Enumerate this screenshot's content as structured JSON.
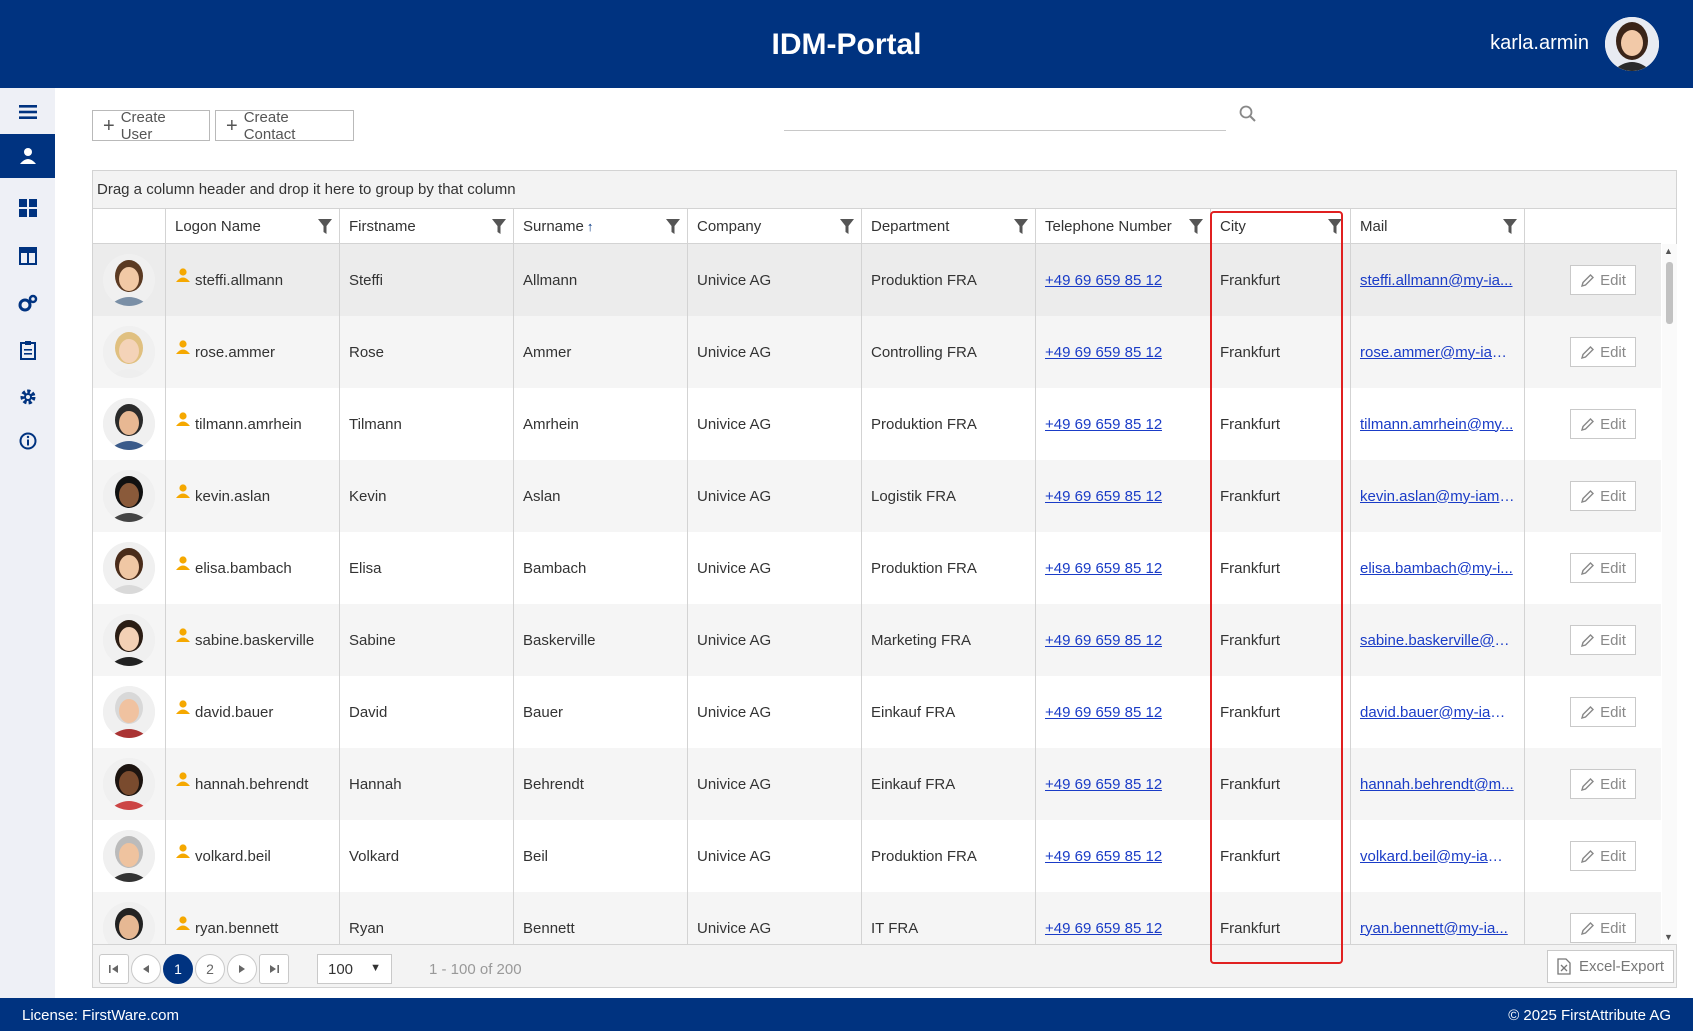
{
  "app": {
    "title": "IDM-Portal",
    "username": "karla.armin"
  },
  "sidebar": {
    "items": [
      {
        "name": "menu-icon"
      },
      {
        "name": "user-icon"
      },
      {
        "name": "dashboard-icon"
      },
      {
        "name": "columns-icon"
      },
      {
        "name": "gears-icon"
      },
      {
        "name": "clipboard-icon"
      },
      {
        "name": "settings-icon"
      },
      {
        "name": "info-icon"
      }
    ]
  },
  "toolbar": {
    "create_user": "Create User",
    "create_contact": "Create Contact",
    "search_placeholder": "",
    "search_value": ""
  },
  "grid": {
    "group_hint": "Drag a column header and drop it here to group by that column",
    "columns": [
      "Logon Name",
      "Firstname",
      "Surname",
      "Company",
      "Department",
      "Telephone Number",
      "City",
      "Mail"
    ],
    "sort_column": "Surname",
    "sort_indicator": "↑",
    "edit_label": "Edit",
    "rows": [
      {
        "logon": "steffi.allmann",
        "first": "Steffi",
        "last": "Allmann",
        "company": "Univice AG",
        "dept": "Produktion FRA",
        "phone": "+49 69 659 85 12",
        "city": "Frankfurt",
        "mail": "steffi.allmann@my-ia..."
      },
      {
        "logon": "rose.ammer",
        "first": "Rose",
        "last": "Ammer",
        "company": "Univice AG",
        "dept": "Controlling FRA",
        "phone": "+49 69 659 85 12",
        "city": "Frankfurt",
        "mail": "rose.ammer@my-iam..."
      },
      {
        "logon": "tilmann.amrhein",
        "first": "Tilmann",
        "last": "Amrhein",
        "company": "Univice AG",
        "dept": "Produktion FRA",
        "phone": "+49 69 659 85 12",
        "city": "Frankfurt",
        "mail": "tilmann.amrhein@my..."
      },
      {
        "logon": "kevin.aslan",
        "first": "Kevin",
        "last": "Aslan",
        "company": "Univice AG",
        "dept": "Logistik FRA",
        "phone": "+49 69 659 85 12",
        "city": "Frankfurt",
        "mail": "kevin.aslan@my-iam...."
      },
      {
        "logon": "elisa.bambach",
        "first": "Elisa",
        "last": "Bambach",
        "company": "Univice AG",
        "dept": "Produktion FRA",
        "phone": "+49 69 659 85 12",
        "city": "Frankfurt",
        "mail": "elisa.bambach@my-i..."
      },
      {
        "logon": "sabine.baskerville",
        "first": "Sabine",
        "last": "Baskerville",
        "company": "Univice AG",
        "dept": "Marketing FRA",
        "phone": "+49 69 659 85 12",
        "city": "Frankfurt",
        "mail": "sabine.baskerville@m..."
      },
      {
        "logon": "david.bauer",
        "first": "David",
        "last": "Bauer",
        "company": "Univice AG",
        "dept": "Einkauf FRA",
        "phone": "+49 69 659 85 12",
        "city": "Frankfurt",
        "mail": "david.bauer@my-iam..."
      },
      {
        "logon": "hannah.behrendt",
        "first": "Hannah",
        "last": "Behrendt",
        "company": "Univice AG",
        "dept": "Einkauf FRA",
        "phone": "+49 69 659 85 12",
        "city": "Frankfurt",
        "mail": "hannah.behrendt@m..."
      },
      {
        "logon": "volkard.beil",
        "first": "Volkard",
        "last": "Beil",
        "company": "Univice AG",
        "dept": "Produktion FRA",
        "phone": "+49 69 659 85 12",
        "city": "Frankfurt",
        "mail": "volkard.beil@my-iam...."
      },
      {
        "logon": "ryan.bennett",
        "first": "Ryan",
        "last": "Bennett",
        "company": "Univice AG",
        "dept": "IT FRA",
        "phone": "+49 69 659 85 12",
        "city": "Frankfurt",
        "mail": "ryan.bennett@my-ia..."
      }
    ]
  },
  "pager": {
    "pages": [
      "1",
      "2"
    ],
    "current_page": "1",
    "page_size": "100",
    "info": "1 - 100 of 200",
    "excel_export": "Excel-Export"
  },
  "footer": {
    "license": "License: FirstWare.com",
    "copyright": "© 2025 FirstAttribute AG"
  },
  "colors": {
    "brand": "#003380",
    "link": "#1a3cc7",
    "user_icon": "#f5a800",
    "highlight": "#e02020"
  }
}
